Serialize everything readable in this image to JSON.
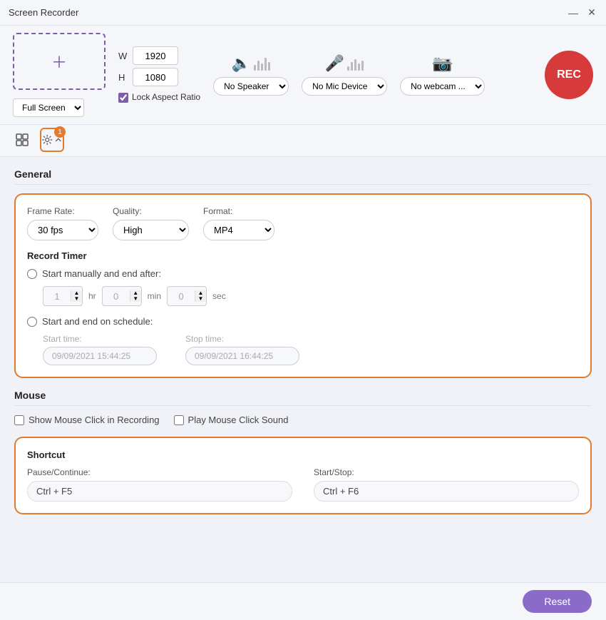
{
  "titlebar": {
    "title": "Screen Recorder",
    "minimize": "—",
    "close": "✕"
  },
  "toolbar": {
    "width_label": "W",
    "height_label": "H",
    "width_value": "1920",
    "height_value": "1080",
    "lock_aspect_label": "Lock Aspect Ratio",
    "fullscreen_option": "Full Screen",
    "speaker_label": "No Speaker",
    "mic_label": "No Mic Device",
    "webcam_label": "No webcam ...",
    "rec_label": "REC",
    "badge_count": "1"
  },
  "settings": {
    "general_title": "General",
    "frame_rate_label": "Frame Rate:",
    "frame_rate_value": "30 fps",
    "quality_label": "Quality:",
    "quality_value": "High",
    "format_label": "Format:",
    "format_value": "MP4",
    "record_timer_title": "Record Timer",
    "start_manually_label": "Start manually and end after:",
    "hr_unit": "hr",
    "min_unit": "min",
    "sec_unit": "sec",
    "start_end_schedule_label": "Start and end on schedule:",
    "start_time_label": "Start time:",
    "start_time_value": "09/09/2021 15:44:25",
    "stop_time_label": "Stop time:",
    "stop_time_value": "09/09/2021 16:44:25",
    "mouse_title": "Mouse",
    "show_mouse_click_label": "Show Mouse Click in Recording",
    "play_mouse_sound_label": "Play Mouse Click Sound",
    "shortcut_title": "Shortcut",
    "pause_continue_label": "Pause/Continue:",
    "pause_continue_value": "Ctrl + F5",
    "start_stop_label": "Start/Stop:",
    "start_stop_value": "Ctrl + F6",
    "time_hr": "1",
    "time_min": "0",
    "time_sec": "0"
  },
  "footer": {
    "reset_label": "Reset"
  }
}
